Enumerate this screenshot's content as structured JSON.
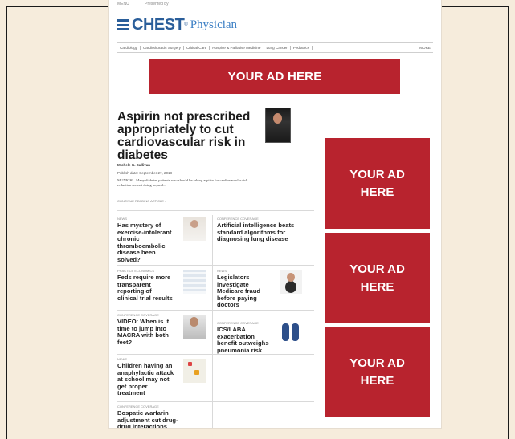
{
  "site": {
    "topbar": [
      "MENU",
      "Presented by"
    ],
    "logo_name": "CHEST",
    "logo_tm": "®",
    "logo_sub": "Physician",
    "nav": [
      "Cardiology",
      "Cardiothoracic Surgery",
      "Critical Care",
      "Hospice & Palliative Medicine",
      "Lung Cancer",
      "Pediatrics"
    ],
    "nav_more": "MORE"
  },
  "ads": {
    "banner": "YOUR AD HERE",
    "side_line1": "YOUR AD",
    "side_line2": "HERE"
  },
  "feature": {
    "headline": "Aspirin not prescribed appropriately to cut cardiovascular risk in diabetes",
    "byline": "Michele G. Sullivan",
    "published": "Publish date: September 27, 2018",
    "teaser": "MUNICH – Many diabetes patients who should be taking aspirin for cardiovascular risk reduction are not doing so, and...",
    "continue": "CONTINUE READING ARTICLE ›"
  },
  "cards": [
    {
      "tag": "NEWS",
      "title": "Has mystery of exercise-intolerant chronic thromboembolic disease been solved?"
    },
    {
      "tag": "CONFERENCE COVERAGE",
      "title": "Artificial intelligence beats standard algorithms for diagnosing lung disease"
    },
    {
      "tag": "PRACTICE ECONOMICS",
      "title": "Feds require more transparent reporting of clinical trial results"
    },
    {
      "tag": "NEWS",
      "title": "Legislators investigate Medicare fraud before paying doctors"
    },
    {
      "tag": "CONFERENCE COVERAGE",
      "title": "VIDEO: When is it time to jump into MACRA with both feet?"
    },
    {
      "tag": "CONFERENCE COVERAGE",
      "title": "ICS/LABA exacerbation benefit outweighs pneumonia risk"
    },
    {
      "tag": "NEWS",
      "title": "Children having an anaphylactic attack at school may not get proper treatment"
    },
    {
      "tag": "CONFERENCE COVERAGE",
      "title": "Bospatic warfarin adjustment cut drug-drug interactions"
    }
  ]
}
